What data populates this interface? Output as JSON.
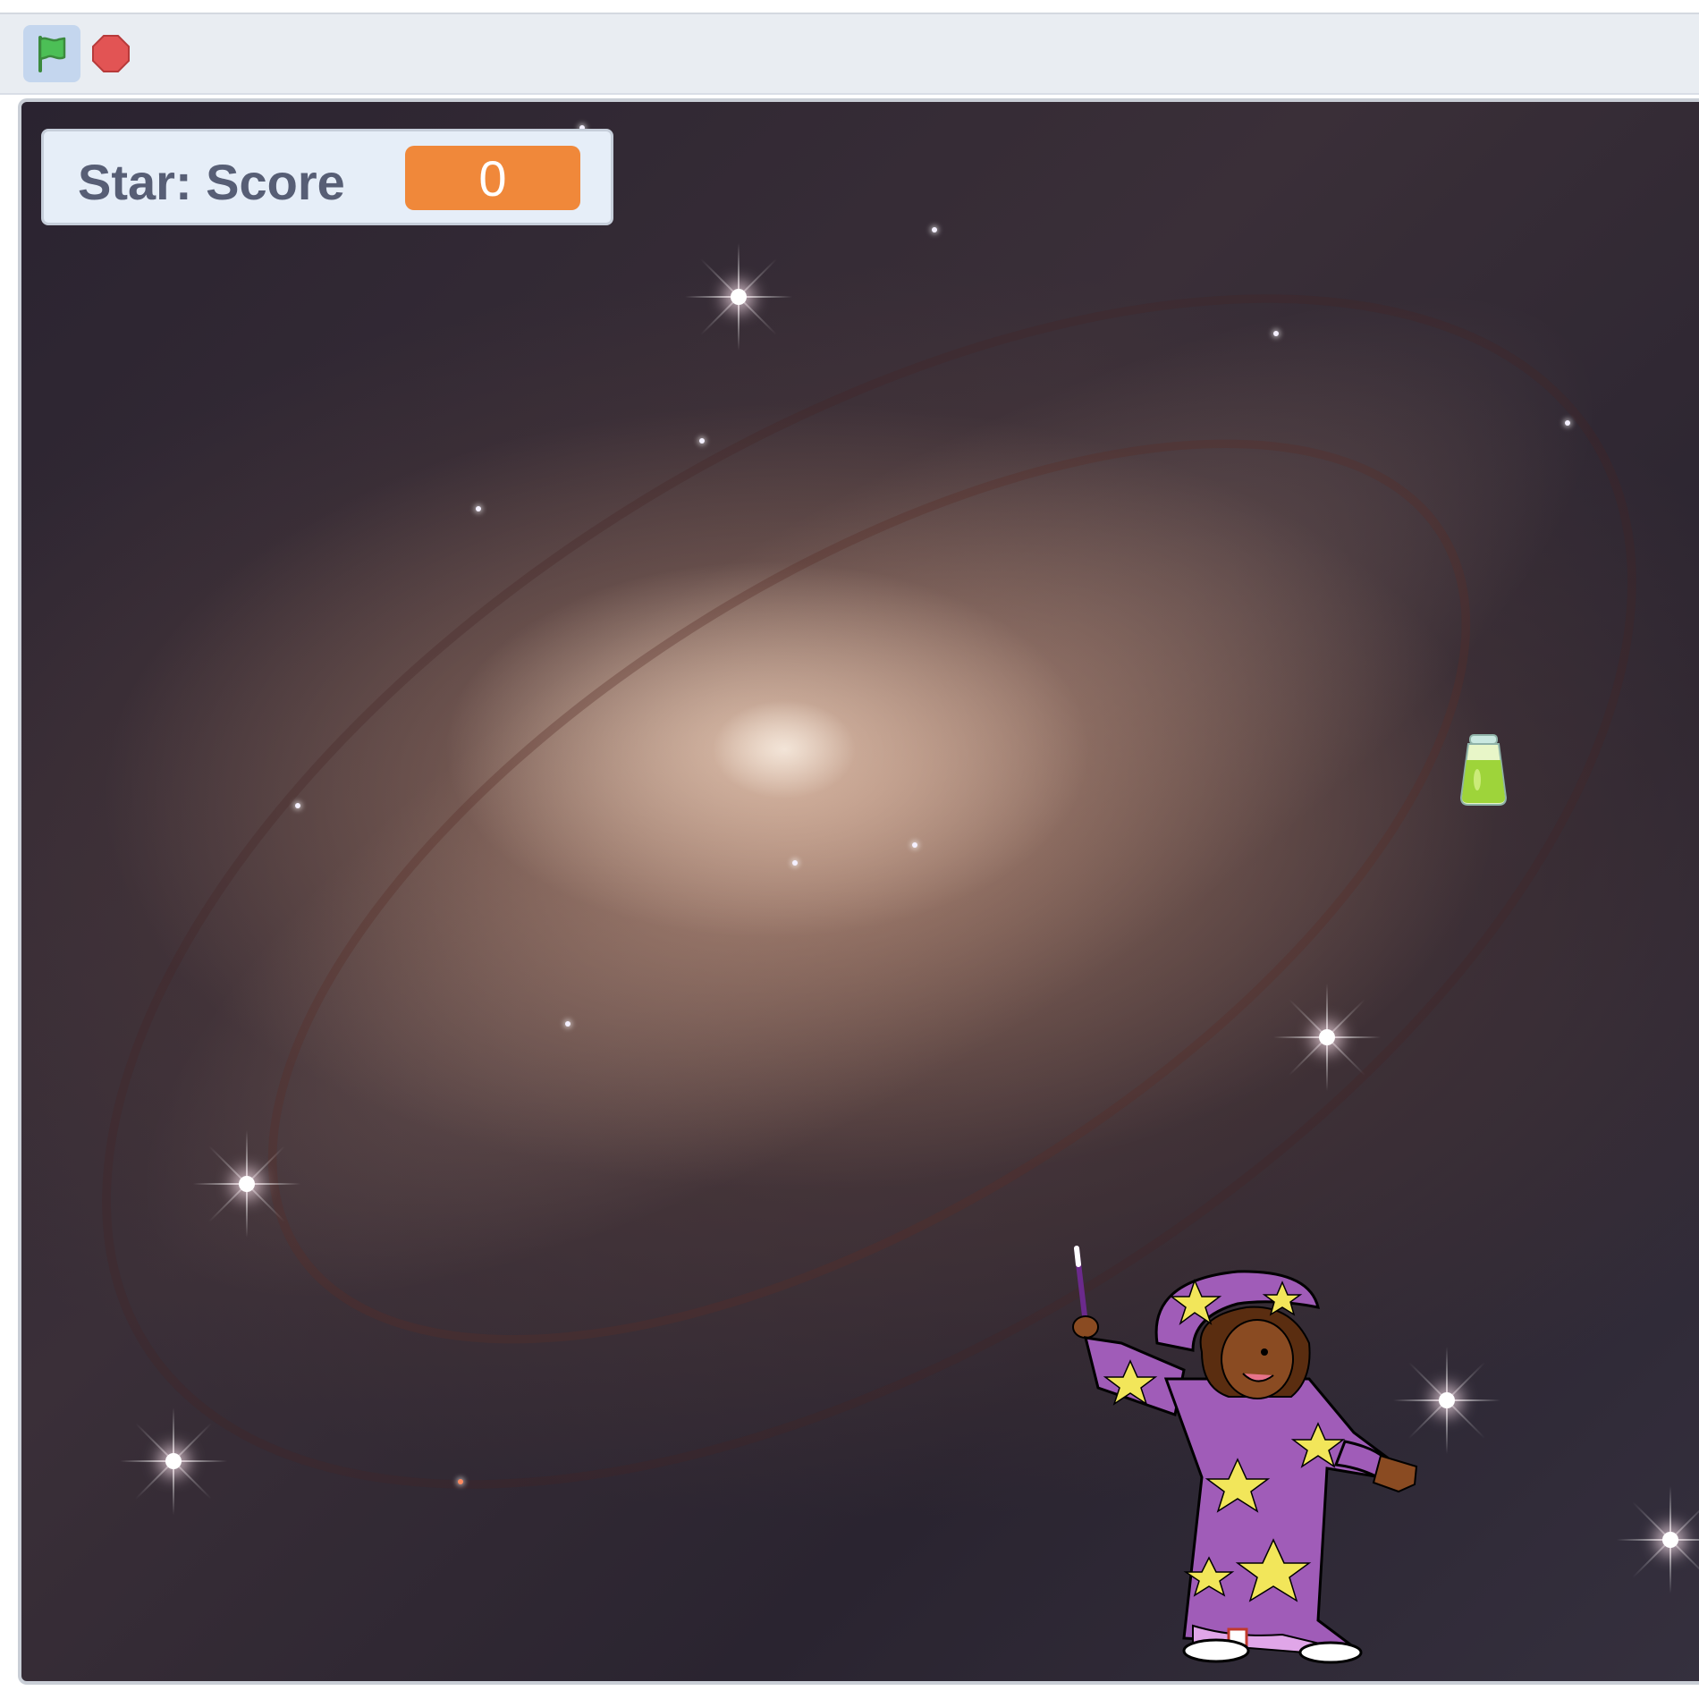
{
  "toolbar": {
    "green_flag_icon": "green-flag-icon",
    "stop_icon": "stop-sign-icon"
  },
  "stage": {
    "backdrop": "spiral-galaxy",
    "monitor": {
      "label": "Star: Score",
      "value": "0"
    },
    "sprites": [
      {
        "name": "potion",
        "icon": "potion-bottle-icon"
      },
      {
        "name": "wizard",
        "icon": "wizard-icon"
      }
    ]
  },
  "colors": {
    "toolbar_bg": "#e9edf2",
    "flag_green": "#4cbf56",
    "stop_red": "#e25454",
    "monitor_bg": "#e6eef8",
    "monitor_value": "#f0883a",
    "monitor_text": "#575e75"
  }
}
